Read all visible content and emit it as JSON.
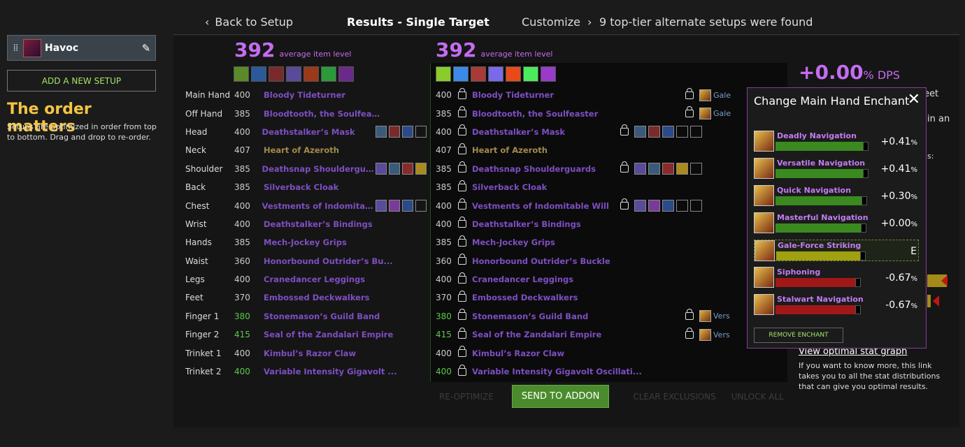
{
  "sidebar": {
    "setup_name": "Havoc",
    "add_button": "ADD A NEW SETUP",
    "order_title": "The order matters",
    "order_text": "Setups are optimized in order from top to bottom. Drag and drop to re-order."
  },
  "nav": {
    "back": "Back to Setup",
    "title": "Results - Single Target",
    "customize": "Customize",
    "alternates": "9 top-tier alternate setups were found"
  },
  "left": {
    "ilvl": "392",
    "ilvl_label": "average item level"
  },
  "right": {
    "ilvl": "392",
    "ilvl_label": "average item level"
  },
  "slots": [
    {
      "slot": "Main Hand",
      "left_ilvl": "400",
      "left_item": "Bloody Tideturner",
      "right_ilvl": "400",
      "right_item": "Bloody Tideturner",
      "enchant": "Gale"
    },
    {
      "slot": "Off Hand",
      "left_ilvl": "385",
      "left_item": "Bloodtooth, the Soulfeaster",
      "right_ilvl": "385",
      "right_item": "Bloodtooth, the Soulfeaster",
      "enchant": "Gale"
    },
    {
      "slot": "Head",
      "left_ilvl": "400",
      "left_item": "Deathstalker’s Mask",
      "right_ilvl": "400",
      "right_item": "Deathstalker’s Mask"
    },
    {
      "slot": "Neck",
      "left_ilvl": "407",
      "left_item": "Heart of Azeroth",
      "right_ilvl": "407",
      "right_item": "Heart of Azeroth"
    },
    {
      "slot": "Shoulder",
      "left_ilvl": "385",
      "left_item": "Deathsnap Shoulderguards",
      "right_ilvl": "385",
      "right_item": "Deathsnap Shoulderguards"
    },
    {
      "slot": "Back",
      "left_ilvl": "385",
      "left_item": "Silverback Cloak",
      "right_ilvl": "385",
      "right_item": "Silverback Cloak"
    },
    {
      "slot": "Chest",
      "left_ilvl": "400",
      "left_item": "Vestments of Indomitable ...",
      "right_ilvl": "400",
      "right_item": "Vestments of Indomitable Will"
    },
    {
      "slot": "Wrist",
      "left_ilvl": "400",
      "left_item": "Deathstalker’s Bindings",
      "right_ilvl": "400",
      "right_item": "Deathstalker’s Bindings"
    },
    {
      "slot": "Hands",
      "left_ilvl": "385",
      "left_item": "Mech-Jockey Grips",
      "right_ilvl": "385",
      "right_item": "Mech-Jockey Grips"
    },
    {
      "slot": "Waist",
      "left_ilvl": "360",
      "left_item": "Honorbound Outrider’s Bu...",
      "right_ilvl": "360",
      "right_item": "Honorbound Outrider’s Buckle"
    },
    {
      "slot": "Legs",
      "left_ilvl": "400",
      "left_item": "Cranedancer Leggings",
      "right_ilvl": "400",
      "right_item": "Cranedancer Leggings"
    },
    {
      "slot": "Feet",
      "left_ilvl": "370",
      "left_item": "Embossed Deckwalkers",
      "right_ilvl": "370",
      "right_item": "Embossed Deckwalkers"
    },
    {
      "slot": "Finger 1",
      "left_ilvl": "380",
      "left_item": "Stonemason’s Guild Band",
      "right_ilvl": "380",
      "right_item": "Stonemason’s Guild Band",
      "enchant": "Vers"
    },
    {
      "slot": "Finger 2",
      "left_ilvl": "415",
      "left_item": "Seal of the Zandalari Empire",
      "right_ilvl": "415",
      "right_item": "Seal of the Zandalari Empire",
      "enchant": "Vers"
    },
    {
      "slot": "Trinket 1",
      "left_ilvl": "400",
      "left_item": "Kimbul’s Razor Claw",
      "right_ilvl": "400",
      "right_item": "Kimbul’s Razor Claw"
    },
    {
      "slot": "Trinket 2",
      "left_ilvl": "400",
      "left_item": "Variable Intensity Gigavolt ...",
      "right_ilvl": "400",
      "right_item": "Variable Intensity Gigavolt Oscillati..."
    }
  ],
  "actions": {
    "reoptimize": "RE-OPTIMIZE",
    "send": "SEND TO ADDON",
    "clear": "CLEAR EXCLUSIONS",
    "unlock": "UNLOCK ALL"
  },
  "dps": {
    "value": "+0.00",
    "unit": "% DPS"
  },
  "popup": {
    "title": "Change Main Hand Enchant",
    "enchants": [
      {
        "name": "Deadly Navigation",
        "value": "+0.41",
        "unit": "%",
        "fill": 0.83
      },
      {
        "name": "Versatile Navigation",
        "value": "+0.41",
        "unit": "%",
        "fill": 0.83
      },
      {
        "name": "Quick Navigation",
        "value": "+0.30",
        "unit": "%",
        "fill": 0.82
      },
      {
        "name": "Masterful Navigation",
        "value": "+0.00",
        "unit": "%",
        "fill": 0.81
      },
      {
        "name": "Gale-Force Striking",
        "value": "E",
        "unit": "",
        "fill": 0.8
      },
      {
        "name": "Siphoning",
        "value": "-0.67",
        "unit": "%",
        "fill": 0.76
      },
      {
        "name": "Stalwart Navigation",
        "value": "-0.67",
        "unit": "%",
        "fill": 0.76
      }
    ],
    "remove": "REMOVE ENCHANT"
  },
  "panel": {
    "eet": "eet",
    "in_an": "in an",
    "s_colon": "s:",
    "stat_graph": "View optimal stat graph",
    "stat_text": "If you want to know more, this link takes you to all the stat distributions that can give you optimal results."
  }
}
